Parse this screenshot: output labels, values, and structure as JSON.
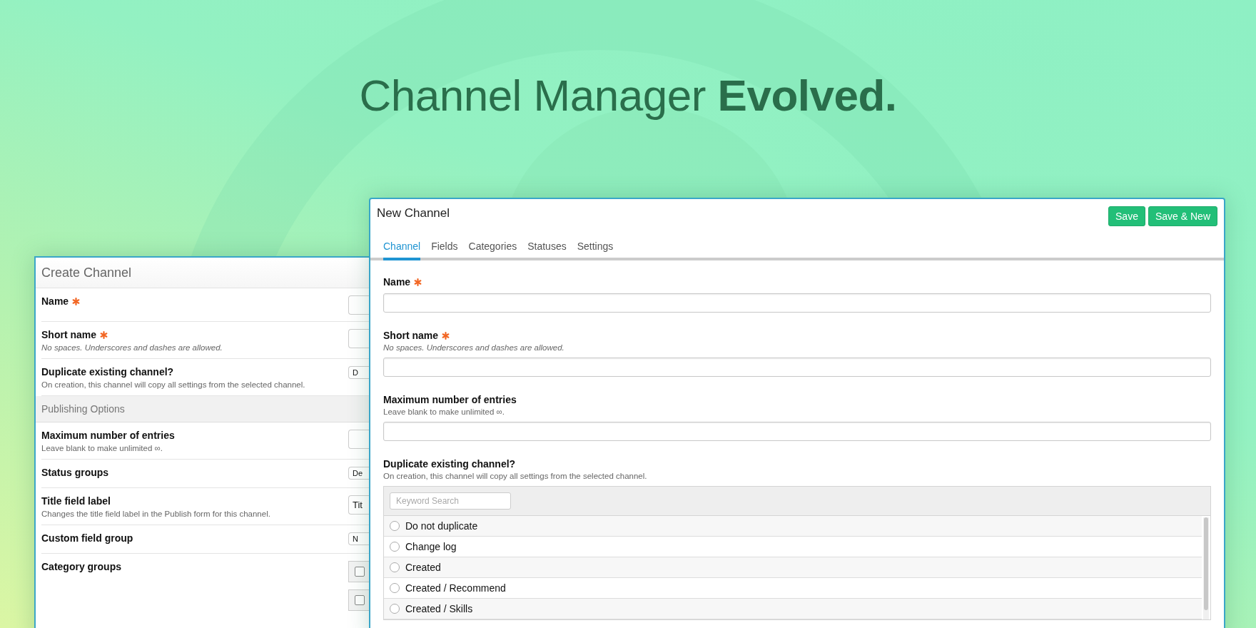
{
  "headline": "Channel Manager **Evolved.**",
  "back_panel": {
    "title": "Create Channel",
    "rows": [
      {
        "kind": "field",
        "label": "Name",
        "required": true,
        "control": {
          "kind": "input"
        }
      },
      {
        "kind": "field",
        "label": "Short name",
        "required": true,
        "hint": "No spaces. Underscores and dashes are allowed.",
        "hint_italic": true,
        "control": {
          "kind": "input"
        }
      },
      {
        "kind": "field",
        "label": "Duplicate existing channel?",
        "required": false,
        "hint": "On creation, this channel will copy all settings from the selected channel.",
        "hint_italic": false,
        "control": {
          "kind": "select",
          "value": "D"
        }
      },
      {
        "kind": "section",
        "label": "Publishing Options"
      },
      {
        "kind": "field",
        "label": "Maximum number of entries",
        "required": false,
        "hint": "Leave blank to make unlimited ∞.",
        "hint_italic": false,
        "control": {
          "kind": "input"
        }
      },
      {
        "kind": "field",
        "label": "Status groups",
        "required": false,
        "control": {
          "kind": "select",
          "value": "De"
        }
      },
      {
        "kind": "field",
        "label": "Title field label",
        "required": false,
        "hint": "Changes the title field label in the Publish form for this channel.",
        "hint_italic": false,
        "control": {
          "kind": "input",
          "value": "Tit"
        }
      },
      {
        "kind": "field",
        "label": "Custom field group",
        "required": false,
        "control": {
          "kind": "select",
          "value": "N"
        }
      },
      {
        "kind": "field",
        "label": "Category groups",
        "required": false,
        "control": {
          "kind": "checkboxes",
          "items": [
            {
              "checked": false
            },
            {
              "checked": false
            }
          ]
        }
      }
    ]
  },
  "front_panel": {
    "title": "New Channel",
    "buttons": [
      "Save",
      "Save & New"
    ],
    "tabs": [
      {
        "label": "Channel",
        "selected": true
      },
      {
        "label": "Fields",
        "selected": false
      },
      {
        "label": "Categories",
        "selected": false
      },
      {
        "label": "Statuses",
        "selected": false
      },
      {
        "label": "Settings",
        "selected": false
      }
    ],
    "fields": [
      {
        "label": "Name",
        "required": true
      },
      {
        "label": "Short name",
        "required": true,
        "hint": "No spaces. Underscores and dashes are allowed.",
        "hint_italic": true
      },
      {
        "label": "Maximum number of entries",
        "required": false,
        "hint": "Leave blank to make unlimited ∞.",
        "hint_italic": false
      }
    ],
    "duplicate": {
      "label": "Duplicate existing channel?",
      "hint": "On creation, this channel will copy all settings from the selected channel.",
      "search": {
        "placeholder": "Keyword Search"
      },
      "options": [
        {
          "label": "Do not duplicate",
          "selected": false
        },
        {
          "label": "Change log",
          "selected": false
        },
        {
          "label": "Created",
          "selected": false
        },
        {
          "label": "Created / Recommend",
          "selected": false
        },
        {
          "label": "Created / Skills",
          "selected": false
        }
      ]
    }
  }
}
